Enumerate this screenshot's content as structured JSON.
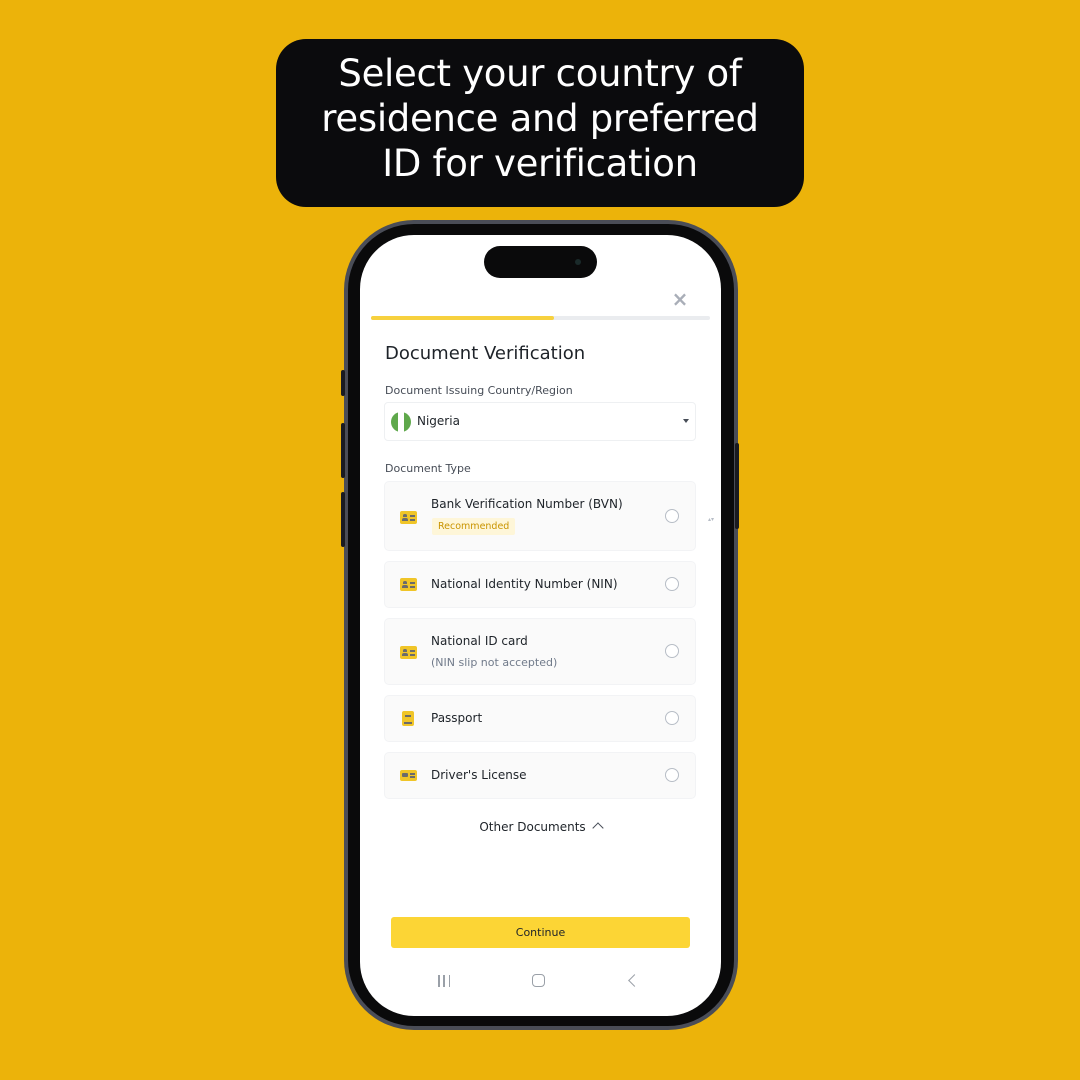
{
  "caption": {
    "lines": [
      "Select your country of",
      "residence and preferred",
      "ID for verification"
    ]
  },
  "screen": {
    "progress_fraction": 0.54,
    "title": "Document Verification",
    "country_label": "Document Issuing Country/Region",
    "country_value": "Nigeria",
    "document_type_label": "Document Type",
    "documents": [
      {
        "title": "Bank Verification Number (BVN)",
        "badge": "Recommended",
        "icon": "id-card-icon",
        "selected": false
      },
      {
        "title": "National Identity Number (NIN)",
        "icon": "id-card-icon",
        "selected": false
      },
      {
        "title": "National ID card",
        "subtitle": "(NIN slip not accepted)",
        "icon": "id-card-icon",
        "selected": false
      },
      {
        "title": "Passport",
        "icon": "passport-icon",
        "selected": false
      },
      {
        "title": "Driver's License",
        "icon": "drivers-license-icon",
        "selected": false
      }
    ],
    "other_documents_label": "Other Documents",
    "continue_label": "Continue"
  },
  "icons": {
    "close": "×",
    "scroll": "▴▾"
  },
  "colors": {
    "background": "#ECB30A",
    "accent": "#FCD535",
    "progress": "#F7D13E",
    "badge_bg": "#FEF6D8",
    "badge_text": "#C99400",
    "flag_green": "#5FA84B"
  }
}
